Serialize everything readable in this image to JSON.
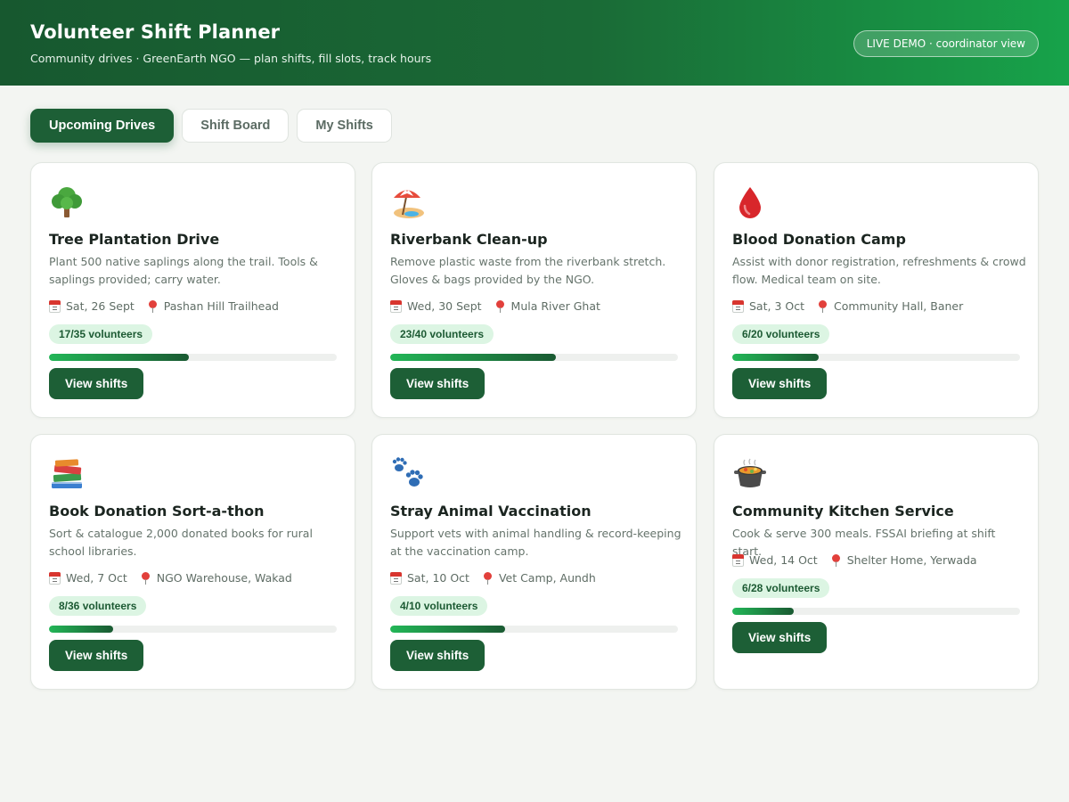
{
  "header": {
    "title": "Volunteer Shift Planner",
    "subtitle": "Community drives · GreenEarth NGO — plan shifts, fill slots, track hours",
    "badge": "LIVE DEMO · coordinator view"
  },
  "tabs": [
    {
      "label": "Upcoming Drives",
      "active": true
    },
    {
      "label": "Shift Board",
      "active": false
    },
    {
      "label": "My Shifts",
      "active": false
    }
  ],
  "colors": {
    "brand": "#1d5f36",
    "header_gradient_end": "#17a34a",
    "pill_bg": "#dcf5e3"
  },
  "drives": [
    {
      "icon": "tree-icon",
      "name": "Tree Plantation Drive",
      "description": "Plant 500 native saplings along the trail. Tools & saplings provided; carry water.",
      "date": "Sat, 26 Sept",
      "location": "Pashan Hill Trailhead",
      "volunteers_label": "17/35 volunteers",
      "filled": 17,
      "capacity": 35,
      "button": "View shifts"
    },
    {
      "icon": "beach-umbrella-icon",
      "name": "Riverbank Clean-up",
      "description": "Remove plastic waste from the riverbank stretch. Gloves & bags provided by the NGO.",
      "date": "Wed, 30 Sept",
      "location": "Mula River Ghat",
      "volunteers_label": "23/40 volunteers",
      "filled": 23,
      "capacity": 40,
      "button": "View shifts"
    },
    {
      "icon": "blood-drop-icon",
      "name": "Blood Donation Camp",
      "description": "Assist with donor registration, refreshments & crowd flow. Medical team on site.",
      "date": "Sat, 3 Oct",
      "location": "Community Hall, Baner",
      "volunteers_label": "6/20 volunteers",
      "filled": 6,
      "capacity": 20,
      "button": "View shifts"
    },
    {
      "icon": "books-icon",
      "name": "Book Donation Sort-a-thon",
      "description": "Sort & catalogue 2,000 donated books for rural school libraries.",
      "date": "Wed, 7 Oct",
      "location": "NGO Warehouse, Wakad",
      "volunteers_label": "8/36 volunteers",
      "filled": 8,
      "capacity": 36,
      "button": "View shifts"
    },
    {
      "icon": "paw-prints-icon",
      "name": "Stray Animal Vaccination",
      "description": "Support vets with animal handling & record-keeping at the vaccination camp.",
      "date": "Sat, 10 Oct",
      "location": "Vet Camp, Aundh",
      "volunteers_label": "4/10 volunteers",
      "filled": 4,
      "capacity": 10,
      "button": "View shifts"
    },
    {
      "icon": "cooking-pot-icon",
      "name": "Community Kitchen Service",
      "description": "Cook & serve 300 meals. FSSAI briefing at shift start.",
      "date": "Wed, 14 Oct",
      "location": "Shelter Home, Yerwada",
      "volunteers_label": "6/28 volunteers",
      "filled": 6,
      "capacity": 28,
      "button": "View shifts"
    }
  ]
}
